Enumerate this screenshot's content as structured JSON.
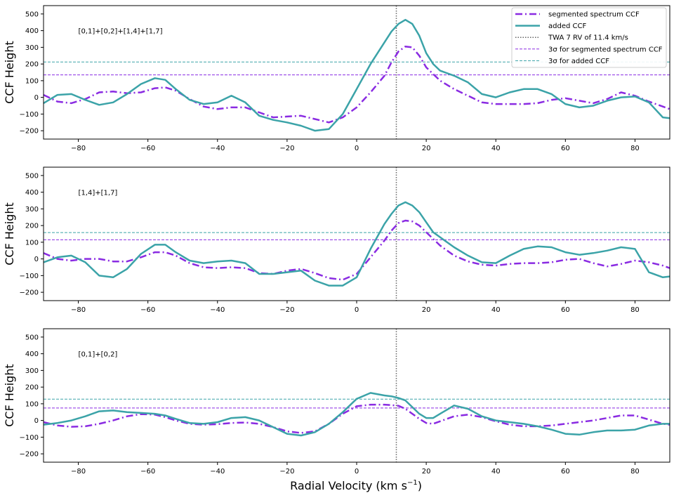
{
  "figure": {
    "xlabel_main": "Radial Velocity (km s",
    "xlabel_sup": "−1",
    "xlabel_close": ")"
  },
  "chart_data": [
    {
      "type": "line",
      "annotation": "[0,1]+[0,2]+[1,4]+[1,7]",
      "ylabel": "CCF Height",
      "xlim": [
        -90,
        90
      ],
      "ylim": [
        -250,
        550
      ],
      "xticks": [
        -80,
        -60,
        -40,
        -20,
        0,
        20,
        40,
        60,
        80
      ],
      "xtick_labels": [
        "−80",
        "−60",
        "−40",
        "−20",
        "0",
        "20",
        "40",
        "60",
        "80"
      ],
      "yticks": [
        -200,
        -100,
        0,
        100,
        200,
        300,
        400,
        500
      ],
      "ytick_labels": [
        "−200",
        "−100",
        "0",
        "100",
        "200",
        "300",
        "400",
        "500"
      ],
      "legend": {
        "placement": "top-right",
        "entries": [
          {
            "label": "segmented spectrum CCF",
            "style": "dashdot-thick",
            "color": "#8a2be2"
          },
          {
            "label": "added CCF",
            "style": "solid-thick",
            "color": "#3ba3a8"
          },
          {
            "label": "TWA 7 RV of 11.4 km/s",
            "style": "dotted",
            "color": "#666666"
          },
          {
            "label": "3σ for segmented spectrum CCF",
            "style": "dashed-thin",
            "color": "#8a2be2"
          },
          {
            "label": "3σ for added CCF",
            "style": "dashed-thin",
            "color": "#3ba3a8"
          }
        ]
      },
      "vline": 11.4,
      "hlines": [
        {
          "name": "3σ for segmented spectrum CCF",
          "y": 135,
          "color": "#8a2be2"
        },
        {
          "name": "3σ for added CCF",
          "y": 212,
          "color": "#3ba3a8"
        }
      ],
      "series": [
        {
          "name": "segmented spectrum CCF",
          "color": "#8a2be2",
          "style": "dashdot",
          "x": [
            -90,
            -86,
            -82,
            -78,
            -74,
            -70,
            -66,
            -62,
            -58,
            -55,
            -52,
            -48,
            -44,
            -40,
            -36,
            -32,
            -28,
            -24,
            -20,
            -16,
            -12,
            -8,
            -4,
            0,
            4,
            8,
            10,
            12,
            14,
            16,
            18,
            20,
            24,
            28,
            32,
            36,
            40,
            44,
            48,
            52,
            56,
            60,
            64,
            68,
            72,
            76,
            80,
            84,
            88,
            90
          ],
          "y": [
            15,
            -25,
            -35,
            -10,
            30,
            35,
            25,
            30,
            55,
            60,
            40,
            -10,
            -55,
            -70,
            -60,
            -60,
            -90,
            -120,
            -115,
            -110,
            -130,
            -150,
            -120,
            -60,
            30,
            130,
            210,
            275,
            305,
            300,
            250,
            180,
            100,
            50,
            10,
            -30,
            -40,
            -40,
            -40,
            -35,
            -15,
            -5,
            -20,
            -35,
            -10,
            30,
            10,
            -25,
            -55,
            -70
          ]
        },
        {
          "name": "added CCF",
          "color": "#3ba3a8",
          "style": "solid",
          "x": [
            -90,
            -86,
            -82,
            -78,
            -74,
            -70,
            -66,
            -62,
            -58,
            -55,
            -52,
            -48,
            -44,
            -40,
            -36,
            -32,
            -28,
            -24,
            -20,
            -16,
            -12,
            -8,
            -4,
            0,
            4,
            8,
            10,
            12,
            14,
            16,
            18,
            20,
            22,
            24,
            28,
            32,
            36,
            40,
            44,
            48,
            52,
            56,
            60,
            64,
            68,
            72,
            76,
            80,
            84,
            88,
            90
          ],
          "y": [
            -35,
            15,
            20,
            -15,
            -45,
            -30,
            20,
            80,
            115,
            105,
            50,
            -15,
            -40,
            -30,
            10,
            -30,
            -110,
            -135,
            -150,
            -170,
            -200,
            -190,
            -100,
            50,
            200,
            330,
            395,
            440,
            465,
            440,
            370,
            265,
            200,
            160,
            130,
            90,
            20,
            0,
            30,
            50,
            50,
            20,
            -40,
            -60,
            -50,
            -20,
            0,
            5,
            -30,
            -120,
            -125
          ]
        }
      ]
    },
    {
      "type": "line",
      "annotation": "[1,4]+[1,7]",
      "ylabel": "CCF Height",
      "xlim": [
        -90,
        90
      ],
      "ylim": [
        -250,
        550
      ],
      "xticks": [
        -80,
        -60,
        -40,
        -20,
        0,
        20,
        40,
        60,
        80
      ],
      "xtick_labels": [
        "−80",
        "−60",
        "−40",
        "−20",
        "0",
        "20",
        "40",
        "60",
        "80"
      ],
      "yticks": [
        -200,
        -100,
        0,
        100,
        200,
        300,
        400,
        500
      ],
      "ytick_labels": [
        "−200",
        "−100",
        "0",
        "100",
        "200",
        "300",
        "400",
        "500"
      ],
      "vline": 11.4,
      "hlines": [
        {
          "name": "3σ for segmented spectrum CCF",
          "y": 115,
          "color": "#8a2be2"
        },
        {
          "name": "3σ for added CCF",
          "y": 158,
          "color": "#3ba3a8"
        }
      ],
      "series": [
        {
          "name": "segmented spectrum CCF",
          "color": "#8a2be2",
          "style": "dashdot",
          "x": [
            -90,
            -86,
            -82,
            -78,
            -74,
            -70,
            -66,
            -62,
            -58,
            -55,
            -52,
            -48,
            -44,
            -40,
            -36,
            -32,
            -28,
            -24,
            -20,
            -16,
            -12,
            -8,
            -4,
            0,
            4,
            8,
            10,
            12,
            14,
            16,
            18,
            20,
            24,
            28,
            32,
            36,
            40,
            44,
            48,
            52,
            56,
            60,
            64,
            68,
            72,
            76,
            80,
            84,
            88,
            90
          ],
          "y": [
            35,
            0,
            -10,
            0,
            0,
            -15,
            -15,
            10,
            40,
            40,
            20,
            -25,
            -50,
            -55,
            -50,
            -55,
            -85,
            -90,
            -70,
            -60,
            -85,
            -115,
            -125,
            -90,
            10,
            110,
            170,
            215,
            230,
            225,
            200,
            160,
            80,
            20,
            -15,
            -35,
            -40,
            -30,
            -25,
            -25,
            -20,
            -5,
            0,
            -25,
            -45,
            -30,
            -10,
            -20,
            -40,
            -55
          ]
        },
        {
          "name": "added CCF",
          "color": "#3ba3a8",
          "style": "solid",
          "x": [
            -90,
            -86,
            -82,
            -78,
            -74,
            -70,
            -66,
            -62,
            -58,
            -55,
            -52,
            -48,
            -44,
            -40,
            -36,
            -32,
            -28,
            -24,
            -20,
            -16,
            -12,
            -8,
            -4,
            0,
            4,
            8,
            10,
            12,
            14,
            16,
            18,
            20,
            22,
            24,
            28,
            32,
            36,
            40,
            44,
            48,
            52,
            56,
            60,
            64,
            68,
            72,
            76,
            80,
            84,
            88,
            90
          ],
          "y": [
            -20,
            10,
            20,
            -20,
            -100,
            -110,
            -60,
            30,
            85,
            85,
            40,
            -10,
            -25,
            -15,
            -10,
            -25,
            -90,
            -90,
            -80,
            -70,
            -130,
            -160,
            -160,
            -110,
            60,
            210,
            270,
            320,
            340,
            320,
            280,
            220,
            160,
            130,
            70,
            20,
            -20,
            -25,
            20,
            60,
            75,
            70,
            40,
            25,
            35,
            50,
            70,
            60,
            -80,
            -110,
            -105
          ]
        }
      ]
    },
    {
      "type": "line",
      "annotation": "[0,1]+[0,2]",
      "ylabel": "CCF Height",
      "xlim": [
        -90,
        90
      ],
      "ylim": [
        -250,
        550
      ],
      "xticks": [
        -80,
        -60,
        -40,
        -20,
        0,
        20,
        40,
        60,
        80
      ],
      "xtick_labels": [
        "−80",
        "−60",
        "−40",
        "−20",
        "0",
        "20",
        "40",
        "60",
        "80"
      ],
      "yticks": [
        -200,
        -100,
        0,
        100,
        200,
        300,
        400,
        500
      ],
      "ytick_labels": [
        "−200",
        "−100",
        "0",
        "100",
        "200",
        "300",
        "400",
        "500"
      ],
      "vline": 11.4,
      "hlines": [
        {
          "name": "3σ for segmented spectrum CCF",
          "y": 75,
          "color": "#8a2be2"
        },
        {
          "name": "3σ for added CCF",
          "y": 128,
          "color": "#3ba3a8"
        }
      ],
      "series": [
        {
          "name": "segmented spectrum CCF",
          "color": "#8a2be2",
          "style": "dashdot",
          "x": [
            -90,
            -86,
            -82,
            -78,
            -74,
            -70,
            -66,
            -62,
            -58,
            -55,
            -52,
            -48,
            -44,
            -40,
            -36,
            -32,
            -28,
            -24,
            -20,
            -16,
            -12,
            -8,
            -4,
            0,
            4,
            8,
            10,
            12,
            14,
            16,
            18,
            20,
            22,
            24,
            28,
            32,
            36,
            40,
            44,
            48,
            52,
            56,
            60,
            64,
            68,
            72,
            76,
            80,
            84,
            88,
            90
          ],
          "y": [
            -10,
            -30,
            -38,
            -35,
            -20,
            0,
            25,
            38,
            35,
            20,
            0,
            -20,
            -25,
            -22,
            -15,
            -12,
            -20,
            -40,
            -65,
            -75,
            -65,
            -20,
            40,
            85,
            95,
            95,
            92,
            88,
            70,
            40,
            10,
            -15,
            -20,
            -5,
            25,
            35,
            20,
            -5,
            -25,
            -35,
            -35,
            -30,
            -20,
            -10,
            0,
            15,
            30,
            30,
            5,
            -20,
            -25
          ]
        },
        {
          "name": "added CCF",
          "color": "#3ba3a8",
          "style": "solid",
          "x": [
            -90,
            -86,
            -82,
            -78,
            -74,
            -70,
            -66,
            -62,
            -58,
            -55,
            -52,
            -48,
            -44,
            -40,
            -36,
            -32,
            -28,
            -24,
            -20,
            -16,
            -12,
            -8,
            -4,
            0,
            4,
            8,
            10,
            12,
            14,
            16,
            18,
            20,
            22,
            24,
            28,
            32,
            36,
            40,
            44,
            48,
            52,
            56,
            60,
            64,
            68,
            72,
            76,
            80,
            84,
            88,
            90
          ],
          "y": [
            -25,
            -15,
            0,
            25,
            55,
            60,
            50,
            45,
            40,
            30,
            10,
            -15,
            -20,
            -10,
            15,
            20,
            0,
            -40,
            -80,
            -90,
            -70,
            -20,
            50,
            130,
            165,
            150,
            145,
            135,
            120,
            80,
            40,
            15,
            15,
            40,
            90,
            70,
            25,
            0,
            -10,
            -20,
            -35,
            -55,
            -80,
            -85,
            -70,
            -60,
            -60,
            -55,
            -30,
            -20,
            -20
          ]
        }
      ]
    }
  ]
}
